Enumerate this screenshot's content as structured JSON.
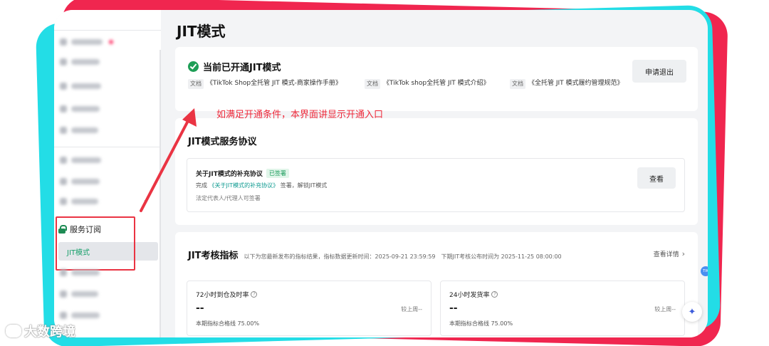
{
  "page": {
    "title": "JIT模式"
  },
  "sidebar": {
    "group_label": "服务订阅",
    "active_item": "JIT模式",
    "side_char": "P"
  },
  "status": {
    "text": "当前已开通JIT模式",
    "exit_button": "申请退出",
    "docs": [
      {
        "tag": "文档",
        "title": "《TikTok Shop全托管 JIT 模式-商家操作手册》"
      },
      {
        "tag": "文档",
        "title": "《TikTok shop全托管 JIT 模式介绍》"
      },
      {
        "tag": "文档",
        "title": "《全托管 JIT 模式履约管理规范》"
      }
    ]
  },
  "annotation": "如满足开通条件，本界面讲显示开通入口",
  "agreement": {
    "section_title": "JIT模式服务协议",
    "title": "关于JIT模式的补充协议",
    "badge": "已签署",
    "desc_prefix": "完成",
    "desc_link": "《关于JIT模式的补充协议》",
    "desc_suffix": "签署，解锁JIT模式",
    "note": "法定代表人/代理人可签署",
    "view_button": "查看"
  },
  "kpi": {
    "title": "JIT考核指标",
    "meta": "以下为您最新发布的指标结果，指标数据更新时间：2025-09-21 23:59:59　下期JIT考核公布时间为 2025-11-25 08:00:00",
    "detail_link": "查看详情",
    "metrics": [
      {
        "name": "72小时到仓及时率",
        "value": "--",
        "compare": "较上周--",
        "pass": "本期指标合格线 75.00%"
      },
      {
        "name": "24小时发货率",
        "value": "--",
        "compare": "较上周--",
        "pass": "本期指标合格线 75.00%"
      }
    ]
  },
  "float_badge": "TIK",
  "watermark": "大数跨境",
  "colors": {
    "accent_green": "#1e9e56",
    "link_teal": "#0d9a90",
    "annotation_red": "#ee2a3b",
    "frame_red": "#f0264f",
    "frame_cyan": "#23dde6"
  }
}
